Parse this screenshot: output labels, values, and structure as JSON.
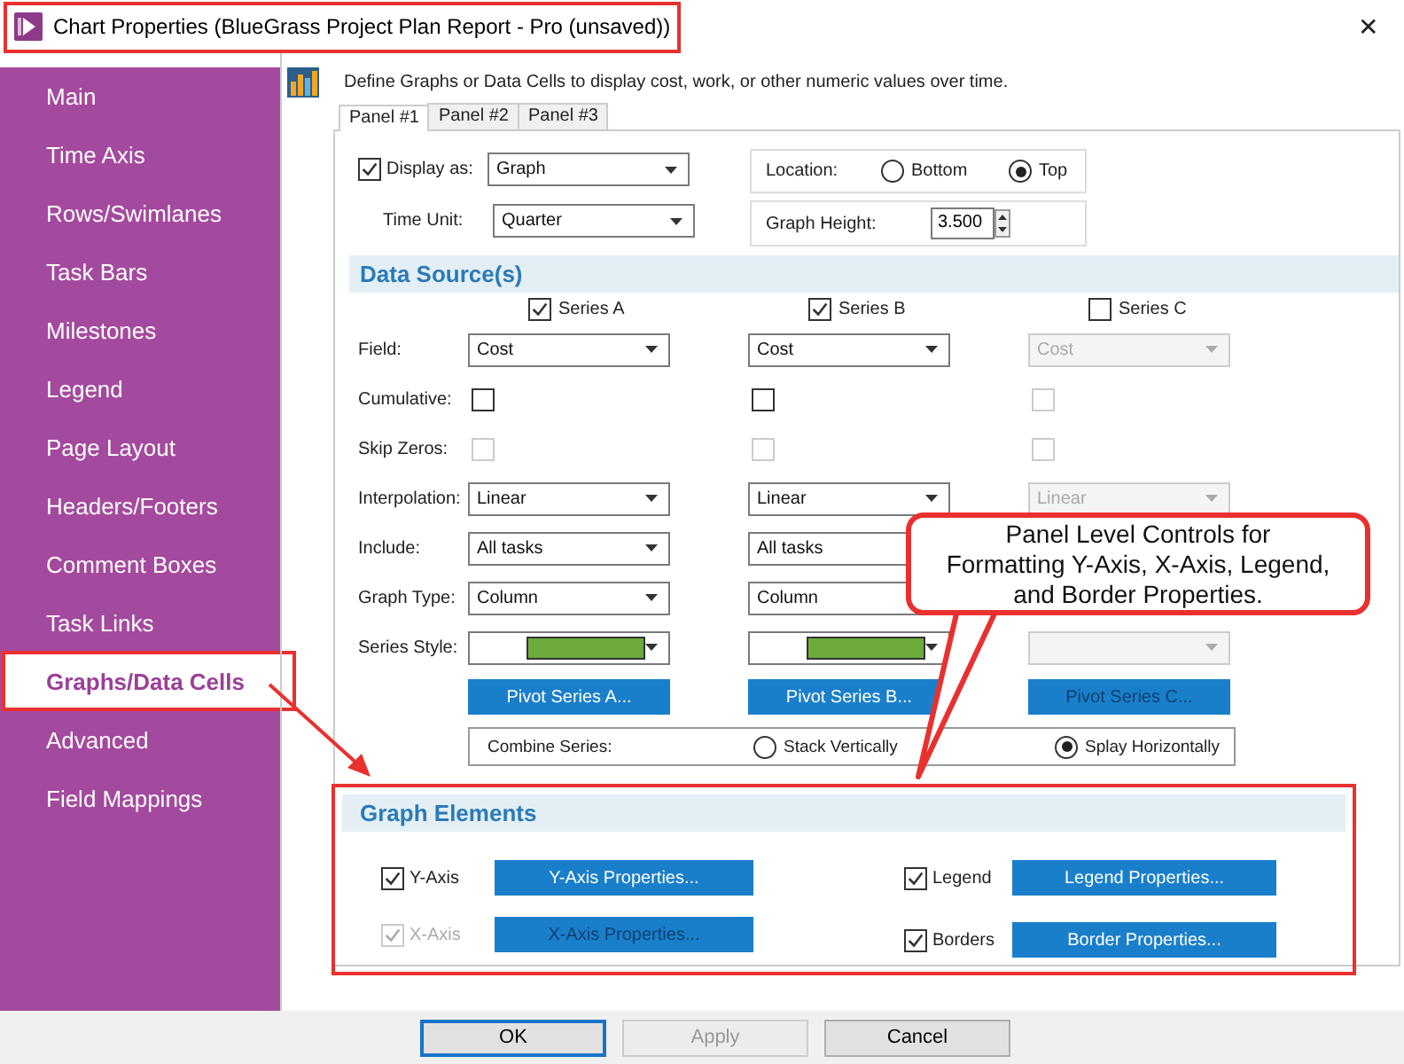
{
  "window": {
    "title": "Chart Properties (BlueGrass Project Plan Report - Pro (unsaved))",
    "highlighted": true,
    "close": "✕"
  },
  "sidebar": {
    "items": [
      {
        "label": "Main",
        "selected": false,
        "highlighted": false
      },
      {
        "label": "Time Axis",
        "selected": false,
        "highlighted": false
      },
      {
        "label": "Rows/Swimlanes",
        "selected": false,
        "highlighted": false
      },
      {
        "label": "Task Bars",
        "selected": false,
        "highlighted": false
      },
      {
        "label": "Milestones",
        "selected": false,
        "highlighted": false
      },
      {
        "label": "Legend",
        "selected": false,
        "highlighted": false
      },
      {
        "label": "Page Layout",
        "selected": false,
        "highlighted": false
      },
      {
        "label": "Headers/Footers",
        "selected": false,
        "highlighted": false
      },
      {
        "label": "Comment Boxes",
        "selected": false,
        "highlighted": false
      },
      {
        "label": "Task Links",
        "selected": false,
        "highlighted": false
      },
      {
        "label": "Graphs/Data Cells",
        "selected": true,
        "highlighted": true
      },
      {
        "label": "Advanced",
        "selected": false,
        "highlighted": false
      },
      {
        "label": "Field Mappings",
        "selected": false,
        "highlighted": false
      }
    ]
  },
  "description": "Define Graphs or Data Cells to display cost, work, or other numeric values over time.",
  "tabs": [
    {
      "label": "Panel #1",
      "selected": true
    },
    {
      "label": "Panel #2",
      "selected": false
    },
    {
      "label": "Panel #3",
      "selected": false
    }
  ],
  "display": {
    "checked": true,
    "label": "Display as:",
    "value": "Graph"
  },
  "time_unit": {
    "label": "Time Unit:",
    "value": "Quarter"
  },
  "location": {
    "label": "Location:",
    "options": [
      {
        "label": "Bottom",
        "selected": false
      },
      {
        "label": "Top",
        "selected": true
      }
    ]
  },
  "graph_height": {
    "label": "Graph Height:",
    "value": "3.500"
  },
  "data_source": {
    "title": "Data Source(s)",
    "series": [
      {
        "label": "Series A",
        "checked": true
      },
      {
        "label": "Series B",
        "checked": true
      },
      {
        "label": "Series C",
        "checked": false
      }
    ],
    "rows": [
      {
        "kind": "dropdown",
        "label": "Field:",
        "cells": [
          {
            "value": "Cost",
            "disabled": false
          },
          {
            "value": "Cost",
            "disabled": false
          },
          {
            "value": "Cost",
            "disabled": true
          }
        ]
      },
      {
        "kind": "checkbox",
        "label": "Cumulative:",
        "cells": [
          {
            "checked": false,
            "disabled": false
          },
          {
            "checked": false,
            "disabled": false
          },
          {
            "checked": false,
            "disabled": true
          }
        ]
      },
      {
        "kind": "checkbox",
        "label": "Skip Zeros:",
        "cells": [
          {
            "checked": false,
            "disabled": true
          },
          {
            "checked": false,
            "disabled": true
          },
          {
            "checked": false,
            "disabled": true
          }
        ]
      },
      {
        "kind": "dropdown",
        "label": "Interpolation:",
        "cells": [
          {
            "value": "Linear",
            "disabled": false
          },
          {
            "value": "Linear",
            "disabled": false
          },
          {
            "value": "Linear",
            "disabled": true
          }
        ]
      },
      {
        "kind": "dropdown",
        "label": "Include:",
        "cells": [
          {
            "value": "All tasks",
            "disabled": false
          },
          {
            "value": "All tasks",
            "disabled": false
          }
        ]
      },
      {
        "kind": "dropdown",
        "label": "Graph Type:",
        "cells": [
          {
            "value": "Column",
            "disabled": false
          },
          {
            "value": "Column",
            "disabled": false
          }
        ]
      },
      {
        "kind": "style",
        "label": "Series Style:",
        "cells": [
          {
            "color": "#6aab3c",
            "disabled": false
          },
          {
            "color": "#6aab3c",
            "disabled": false
          },
          {
            "disabled": true
          }
        ]
      }
    ],
    "pivots": [
      {
        "label": "Pivot Series A...",
        "disabled": false
      },
      {
        "label": "Pivot Series B...",
        "disabled": false
      },
      {
        "label": "Pivot Series C...",
        "disabled": true
      }
    ],
    "combine": {
      "label": "Combine Series:",
      "options": [
        {
          "label": "Stack Vertically",
          "selected": false
        },
        {
          "label": "Splay Horizontally",
          "selected": true
        }
      ]
    }
  },
  "graph_elements": {
    "title": "Graph Elements",
    "highlighted": true,
    "items": [
      {
        "label": "Y-Axis",
        "checked": true,
        "disabled": false,
        "button": "Y-Axis Properties..."
      },
      {
        "label": "Legend",
        "checked": true,
        "disabled": false,
        "button": "Legend Properties..."
      },
      {
        "label": "X-Axis",
        "checked": true,
        "disabled": true,
        "button": "X-Axis Properties..."
      },
      {
        "label": "Borders",
        "checked": true,
        "disabled": false,
        "button": "Border Properties..."
      }
    ]
  },
  "buttons": [
    {
      "label": "OK",
      "default": true,
      "disabled": false
    },
    {
      "label": "Apply",
      "default": false,
      "disabled": true
    },
    {
      "label": "Cancel",
      "default": false,
      "disabled": false
    }
  ],
  "annotations": {
    "callout": "Panel Level Controls for Formatting Y-Axis, X-Axis, Legend, and Border Properties.",
    "arrow": true
  }
}
